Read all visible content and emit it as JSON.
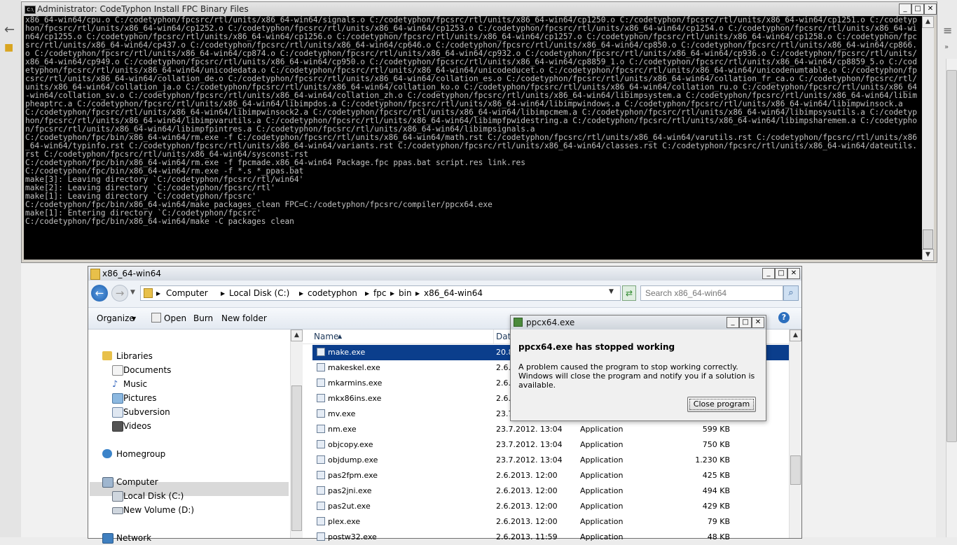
{
  "console": {
    "title": "Administrator: CodeTyphon Install FPC Binary Files",
    "icon_label": "C:\\",
    "text": "x86_64-win64/cpu.o C:/codetyphon/fpcsrc/rtl/units/x86_64-win64/signals.o C:/codetyphon/fpcsrc/rtl/units/x86_64-win64/cp1250.o C:/codetyphon/fpcsrc/rtl/units/x86_64-win64/cp1251.o C:/codetyphon/fpcsrc/rtl/units/x86_64-win64/cp1252.o C:/codetyphon/fpcsrc/rtl/units/x86_64-win64/cp1253.o C:/codetyphon/fpcsrc/rtl/units/x86_64-win64/cp1254.o C:/codetyphon/fpcsrc/rtl/units/x86_64-win64/cp1255.o C:/codetyphon/fpcsrc/rtl/units/x86_64-win64/cp1256.o C:/codetyphon/fpcsrc/rtl/units/x86_64-win64/cp1257.o C:/codetyphon/fpcsrc/rtl/units/x86_64-win64/cp1258.o C:/codetyphon/fpcsrc/rtl/units/x86_64-win64/cp437.o C:/codetyphon/fpcsrc/rtl/units/x86_64-win64/cp646.o C:/codetyphon/fpcsrc/rtl/units/x86_64-win64/cp850.o C:/codetyphon/fpcsrc/rtl/units/x86_64-win64/cp866.o C:/codetyphon/fpcsrc/rtl/units/x86_64-win64/cp874.o C:/codetyphon/fpcsrc/rtl/units/x86_64-win64/cp932.o C:/codetyphon/fpcsrc/rtl/units/x86_64-win64/cp936.o C:/codetyphon/fpcsrc/rtl/units/x86_64-win64/cp949.o C:/codetyphon/fpcsrc/rtl/units/x86_64-win64/cp950.o C:/codetyphon/fpcsrc/rtl/units/x86_64-win64/cp8859_1.o C:/codetyphon/fpcsrc/rtl/units/x86_64-win64/cp8859_5.o C:/codetyphon/fpcsrc/rtl/units/x86_64-win64/unicodedata.o C:/codetyphon/fpcsrc/rtl/units/x86_64-win64/unicodeducet.o C:/codetyphon/fpcsrc/rtl/units/x86_64-win64/unicodenumtable.o C:/codetyphon/fpcsrc/rtl/units/x86_64-win64/collation_de.o C:/codetyphon/fpcsrc/rtl/units/x86_64-win64/collation_es.o C:/codetyphon/fpcsrc/rtl/units/x86_64-win64/collation_fr_ca.o C:/codetyphon/fpcsrc/rtl/units/x86_64-win64/collation_ja.o C:/codetyphon/fpcsrc/rtl/units/x86_64-win64/collation_ko.o C:/codetyphon/fpcsrc/rtl/units/x86_64-win64/collation_ru.o C:/codetyphon/fpcsrc/rtl/units/x86_64-win64/collation_sv.o C:/codetyphon/fpcsrc/rtl/units/x86_64-win64/collation_zh.o C:/codetyphon/fpcsrc/rtl/units/x86_64-win64/libimpsystem.a C:/codetyphon/fpcsrc/rtl/units/x86_64-win64/libimpheaptrc.a C:/codetyphon/fpcsrc/rtl/units/x86_64-win64/libimpdos.a C:/codetyphon/fpcsrc/rtl/units/x86_64-win64/libimpwindows.a C:/codetyphon/fpcsrc/rtl/units/x86_64-win64/libimpwinsock.a C:/codetyphon/fpcsrc/rtl/units/x86_64-win64/libimpwinsock2.a C:/codetyphon/fpcsrc/rtl/units/x86_64-win64/libimpcmem.a C:/codetyphon/fpcsrc/rtl/units/x86_64-win64/libimpsysutils.a C:/codetyphon/fpcsrc/rtl/units/x86_64-win64/libimpvarutils.a C:/codetyphon/fpcsrc/rtl/units/x86_64-win64/libimpfpwidestring.a C:/codetyphon/fpcsrc/rtl/units/x86_64-win64/libimpsharemem.a C:/codetyphon/fpcsrc/rtl/units/x86_64-win64/libimpfpintres.a C:/codetyphon/fpcsrc/rtl/units/x86_64-win64/libimpsignals.a\nC:/codetyphon/fpc/bin/x86_64-win64/rm.exe -f C:/codetyphon/fpcsrc/rtl/units/x86_64-win64/math.rst C:/codetyphon/fpcsrc/rtl/units/x86_64-win64/varutils.rst C:/codetyphon/fpcsrc/rtl/units/x86_64-win64/typinfo.rst C:/codetyphon/fpcsrc/rtl/units/x86_64-win64/variants.rst C:/codetyphon/fpcsrc/rtl/units/x86_64-win64/classes.rst C:/codetyphon/fpcsrc/rtl/units/x86_64-win64/dateutils.rst C:/codetyphon/fpcsrc/rtl/units/x86_64-win64/sysconst.rst\nC:/codetyphon/fpc/bin/x86_64-win64/rm.exe -f fpcmade.x86_64-win64 Package.fpc ppas.bat script.res link.res\nC:/codetyphon/fpc/bin/x86_64-win64/rm.exe -f *.s *_ppas.bat\nmake[3]: Leaving directory `C:/codetyphon/fpcsrc/rtl/win64'\nmake[2]: Leaving directory `C:/codetyphon/fpcsrc/rtl'\nmake[1]: Leaving directory `C:/codetyphon/fpcsrc'\nC:/codetyphon/fpc/bin/x86_64-win64/make packages_clean FPC=C:/codetyphon/fpcsrc/compiler/ppcx64.exe\nmake[1]: Entering directory `C:/codetyphon/fpcsrc'\nC:/codetyphon/fpc/bin/x86_64-win64/make -C packages clean"
  },
  "window_buttons": {
    "minimize": "_",
    "maximize": "□",
    "close": "✕"
  },
  "explorer": {
    "title": "x86_64-win64",
    "breadcrumb": [
      "Computer",
      "Local Disk (C:)",
      "codetyphon",
      "fpc",
      "bin",
      "x86_64-win64"
    ],
    "search_placeholder": "Search x86_64-win64",
    "toolbar": {
      "organize": "Organize",
      "open": "Open",
      "burn": "Burn",
      "new_folder": "New folder"
    },
    "nav": {
      "libraries": "Libraries",
      "documents": "Documents",
      "music": "Music",
      "pictures": "Pictures",
      "subversion": "Subversion",
      "videos": "Videos",
      "homegroup": "Homegroup",
      "computer": "Computer",
      "local_disk": "Local Disk (C:)",
      "new_volume": "New Volume (D:)",
      "network": "Network"
    },
    "columns": {
      "name": "Name",
      "date": "Date"
    },
    "files": [
      {
        "name": "make.exe",
        "date": "20.8",
        "type": "",
        "size": ""
      },
      {
        "name": "makeskel.exe",
        "date": "2.6.",
        "type": "",
        "size": ""
      },
      {
        "name": "mkarmins.exe",
        "date": "2.6.",
        "type": "",
        "size": ""
      },
      {
        "name": "mkx86ins.exe",
        "date": "2.6.",
        "type": "",
        "size": ""
      },
      {
        "name": "mv.exe",
        "date": "23.7",
        "type": "",
        "size": ""
      },
      {
        "name": "nm.exe",
        "date": "23.7.2012. 13:04",
        "type": "Application",
        "size": "599 KB"
      },
      {
        "name": "objcopy.exe",
        "date": "23.7.2012. 13:04",
        "type": "Application",
        "size": "750 KB"
      },
      {
        "name": "objdump.exe",
        "date": "23.7.2012. 13:04",
        "type": "Application",
        "size": "1.230 KB"
      },
      {
        "name": "pas2fpm.exe",
        "date": "2.6.2013. 12:00",
        "type": "Application",
        "size": "425 KB"
      },
      {
        "name": "pas2jni.exe",
        "date": "2.6.2013. 12:00",
        "type": "Application",
        "size": "494 KB"
      },
      {
        "name": "pas2ut.exe",
        "date": "2.6.2013. 12:00",
        "type": "Application",
        "size": "429 KB"
      },
      {
        "name": "plex.exe",
        "date": "2.6.2013. 12:00",
        "type": "Application",
        "size": "79 KB"
      },
      {
        "name": "postw32.exe",
        "date": "2.6.2013. 11:59",
        "type": "Application",
        "size": "48 KB"
      }
    ]
  },
  "dialog": {
    "title": "ppcx64.exe",
    "heading": "ppcx64.exe has stopped working",
    "message": "A problem caused the program to stop working correctly. Windows will close the program and notify you if a solution is available.",
    "close_button": "Close program"
  }
}
